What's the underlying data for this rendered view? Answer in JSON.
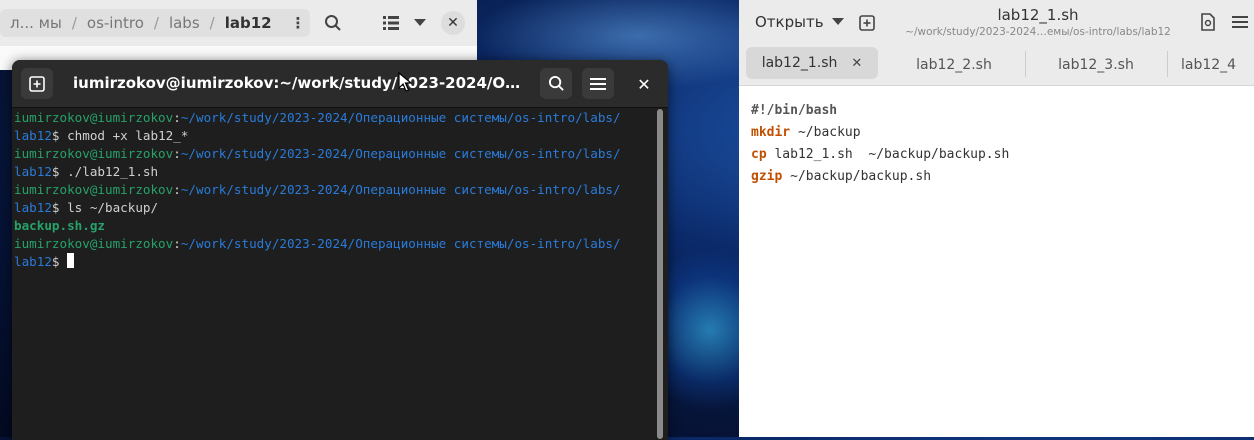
{
  "file_manager": {
    "breadcrumbs": [
      "л... мы",
      "os-intro",
      "labs",
      "lab12"
    ],
    "separator": "/"
  },
  "terminal": {
    "title": "iumirzokov@iumirzokov:~/work/study/2023-2024/Операцион...",
    "prompt_user": "iumirzokov@iumirzokov",
    "prompt_colon": ":",
    "prompt_path": "~/work/study/2023-2024/Операционные системы/os-intro/labs/",
    "prompt_cont": "lab12",
    "prompt_dollar": "$",
    "commands": [
      " chmod +x lab12_*",
      " ./lab12_1.sh",
      " ls ~/backup/",
      " "
    ],
    "ls_output": "backup.sh.gz"
  },
  "editor": {
    "open_label": "Открыть",
    "title": "lab12_1.sh",
    "subtitle": "~/work/study/2023-2024…емы/os-intro/labs/lab12",
    "tabs": [
      {
        "label": "lab12_1.sh"
      },
      {
        "label": "lab12_2.sh"
      },
      {
        "label": "lab12_3.sh"
      },
      {
        "label": "lab12_4"
      }
    ],
    "code": {
      "line1": "#!/bin/bash",
      "line2_kw": "mkdir",
      "line2_rest": " ~/backup",
      "line3_kw": "cp",
      "line3_rest": " lab12_1.sh  ~/backup/backup.sh",
      "line4_kw": "gzip",
      "line4_rest": " ~/backup/backup.sh"
    }
  },
  "colors": {
    "prompt_green": "#26a269",
    "prompt_blue": "#2a7bd8",
    "keyword_orange": "#c24e00"
  }
}
